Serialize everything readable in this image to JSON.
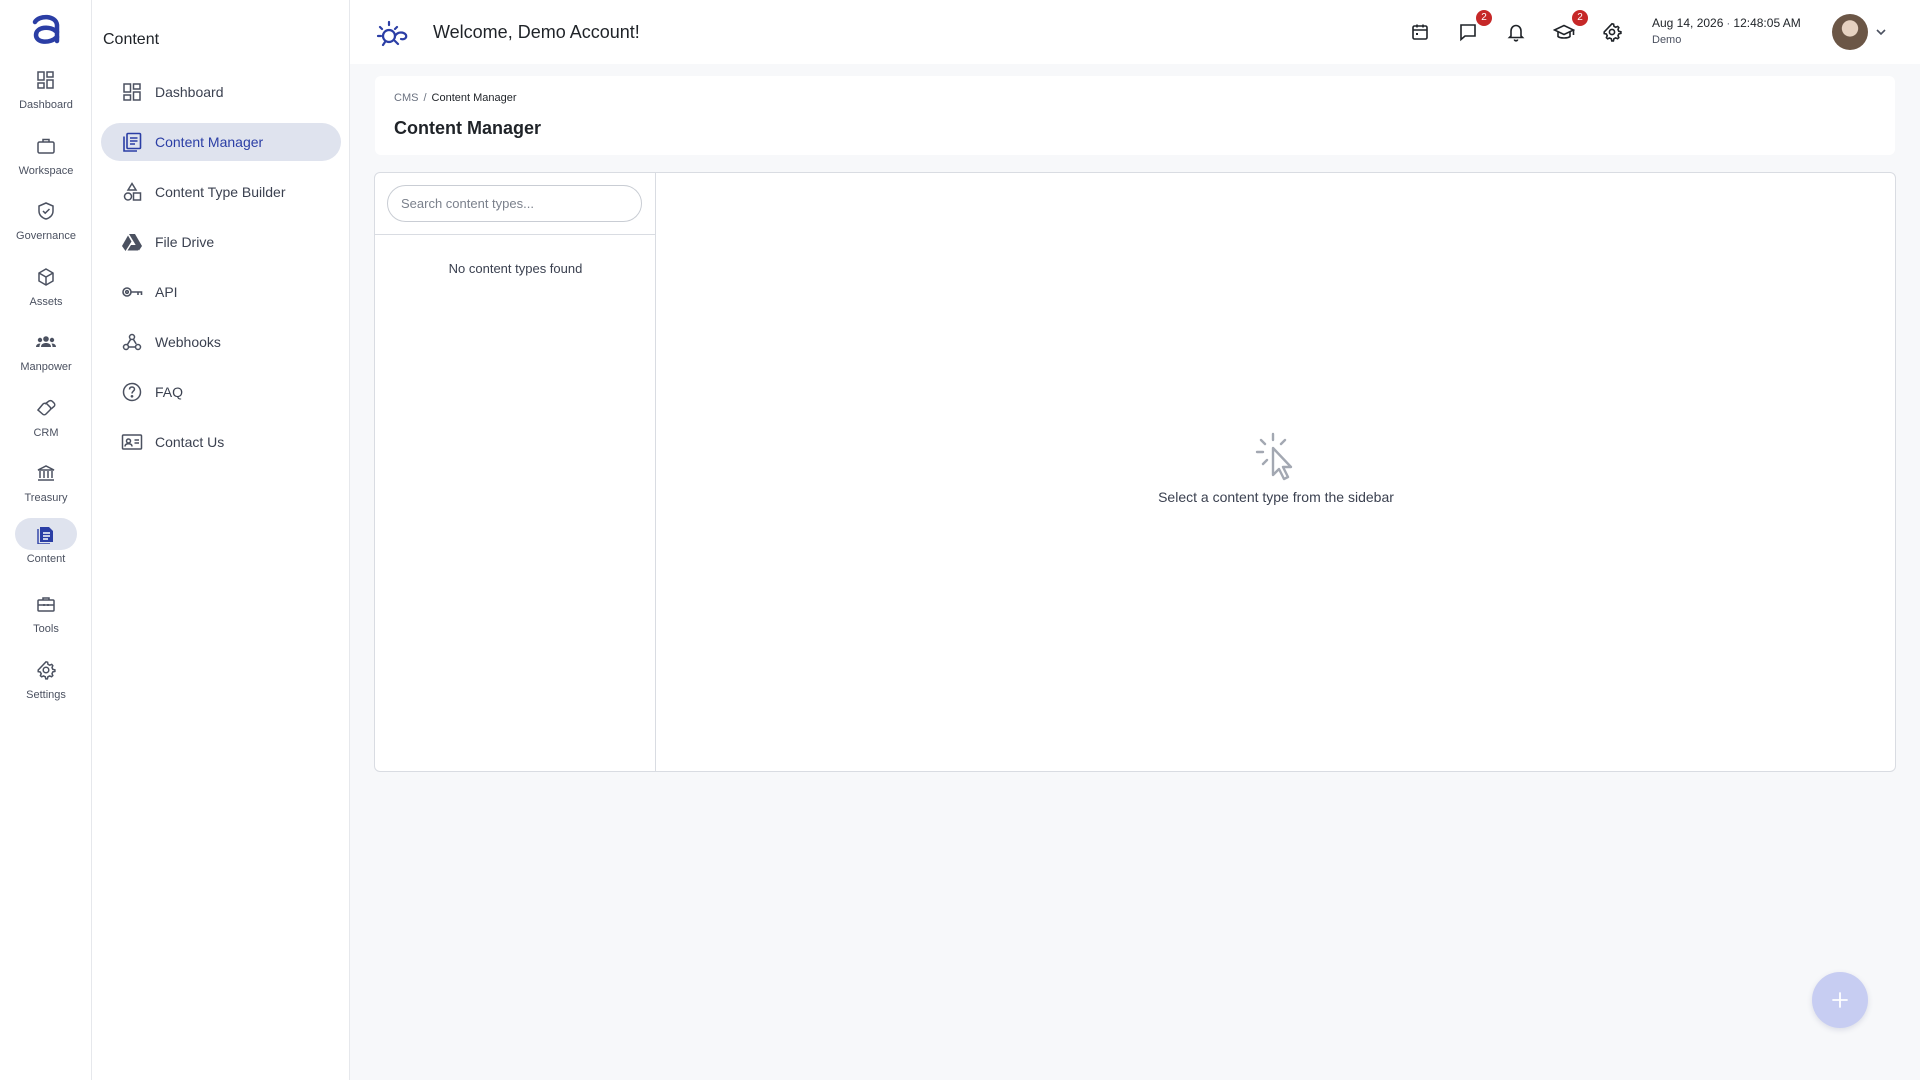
{
  "colors": {
    "accent": "#2b3ea5",
    "active_bg": "#dfe3ee",
    "badge": "#c62828",
    "fab": "#c7cdf2"
  },
  "rail": {
    "logo_icon": "app-logo",
    "items": [
      {
        "label": "Dashboard",
        "icon": "dashboard-icon"
      },
      {
        "label": "Workspace",
        "icon": "briefcase-icon"
      },
      {
        "label": "Governance",
        "icon": "shield-check-icon"
      },
      {
        "label": "Assets",
        "icon": "cube-icon"
      },
      {
        "label": "Manpower",
        "icon": "people-icon"
      },
      {
        "label": "CRM",
        "icon": "handshake-icon"
      },
      {
        "label": "Treasury",
        "icon": "bank-icon"
      },
      {
        "label": "Content",
        "icon": "document-icon",
        "active": true
      },
      {
        "label": "Tools",
        "icon": "toolbox-icon"
      },
      {
        "label": "Settings",
        "icon": "gear-icon"
      }
    ]
  },
  "subnav": {
    "title": "Content",
    "items": [
      {
        "label": "Dashboard",
        "icon": "dashboard-icon"
      },
      {
        "label": "Content Manager",
        "icon": "content-list-icon",
        "active": true
      },
      {
        "label": "Content Type Builder",
        "icon": "shapes-icon"
      },
      {
        "label": "File Drive",
        "icon": "drive-icon"
      },
      {
        "label": "API",
        "icon": "key-icon"
      },
      {
        "label": "Webhooks",
        "icon": "webhook-icon"
      },
      {
        "label": "FAQ",
        "icon": "help-circle-icon"
      },
      {
        "label": "Contact Us",
        "icon": "contact-card-icon"
      }
    ]
  },
  "header": {
    "welcome": "Welcome, Demo Account!",
    "icons": {
      "calendar": {
        "icon": "calendar-icon"
      },
      "messages": {
        "icon": "chat-icon",
        "badge": "2"
      },
      "notifications": {
        "icon": "bell-icon"
      },
      "learning": {
        "icon": "graduation-cap-icon",
        "badge": "2"
      },
      "settings": {
        "icon": "gear-icon"
      }
    },
    "date": "Aug 14, 2026",
    "separator": "·",
    "time": "12:48:05 AM",
    "user_sub": "Demo"
  },
  "breadcrumb": {
    "root": "CMS",
    "separator": "/",
    "current": "Content Manager"
  },
  "page_title": "Content Manager",
  "content_types": {
    "search_placeholder": "Search content types...",
    "search_value": "",
    "empty_text": "No content types found"
  },
  "main": {
    "empty_message": "Select a content type from the sidebar",
    "empty_icon": "pointer-click-icon"
  },
  "fab": {
    "icon": "plus-icon"
  }
}
